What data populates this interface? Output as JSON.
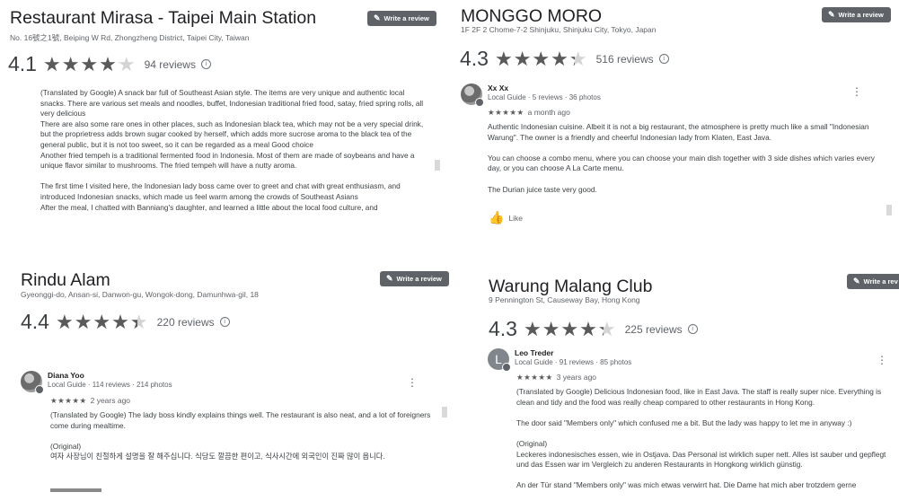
{
  "common": {
    "write_review_label": "Write a review",
    "write_review_short": "Write a rev",
    "like_label": "Like"
  },
  "panels": [
    {
      "name": "Restaurant Mirasa - Taipei Main Station",
      "address": "No. 16號之1號, Beiping W Rd, Zhongzheng District, Taipei City, Taiwan",
      "rating": "4.1",
      "rating_value": 4.1,
      "reviews": "94 reviews",
      "body": [
        "(Translated by Google) A snack bar full of Southeast Asian style. The items are very unique and authentic local snacks. There are various set meals and noodles, buffet, Indonesian traditional fried food, satay, fried spring rolls, all very delicious",
        "There are also some rare ones in other places, such as Indonesian black tea, which may not be a very special drink, but the proprietress adds brown sugar cooked by herself, which adds more sucrose aroma to the black tea of the general public, but it is not too sweet, so it can be regarded as a meal Good choice",
        "Another fried tempeh is a traditional fermented food in Indonesia. Most of them are made of soybeans and have a unique flavor similar to mushrooms. The fried tempeh will have a nutty aroma.",
        "The first time I visited here, the Indonesian lady boss came over to greet and chat with great enthusiasm, and introduced Indonesian snacks, which made us feel warm among the crowds of Southeast Asians",
        "After the meal, I chatted with Banniang's daughter, and learned a little about the local food culture, and"
      ]
    },
    {
      "name": "MONGGO MORO",
      "address": "1F 2F 2 Chome-7-2 Shinjuku, Shinjuku City, Tokyo, Japan",
      "rating": "4.3",
      "rating_value": 4.3,
      "reviews": "516 reviews",
      "reviewer": {
        "name": "Xx Xx",
        "meta": "Local Guide · 5 reviews · 36 photos",
        "stars": "★★★★★",
        "when": "a month ago"
      },
      "body": [
        "Authentic Indonesian cuisine. Albeit it is not a big restaurant, the atmosphere is pretty much like a small \"Indonesian Warung\". The owner is a friendly and cheerful Indonesian lady from Klaten, East Java.",
        "You can choose a combo menu, where you can choose your main dish together with 3 side dishes which varies every day, or you can choose A La Carte menu.",
        "The Durian juice taste very good."
      ]
    },
    {
      "name": "Rindu Alam",
      "address": "Gyeonggi-do, Ansan-si, Danwon-gu, Wongok-dong, Damunhwa-gil, 18",
      "rating": "4.4",
      "rating_value": 4.4,
      "reviews": "220 reviews",
      "reviewer": {
        "name": "Diana Yoo",
        "meta": "Local Guide · 114 reviews · 214 photos",
        "stars": "★★★★★",
        "when": "2 years ago"
      },
      "body": [
        "(Translated by Google) The lady boss kindly explains things well. The restaurant is also neat, and a lot of foreigners come during mealtime.",
        "(Original)",
        "여자 사장님이 친절하게 설명을 잘 해주십니다. 식당도 깔끔한 편이고, 식사시간에 외국인이 진짜 많이 옵니다."
      ]
    },
    {
      "name": "Warung Malang Club",
      "address": "9 Pennington St, Causeway Bay, Hong Kong",
      "rating": "4.3",
      "rating_value": 4.3,
      "reviews": "225 reviews",
      "reviewer": {
        "initial": "L",
        "name": "Leo Treder",
        "meta": "Local Guide · 91 reviews · 85 photos",
        "stars": "★★★★★",
        "when": "3 years ago"
      },
      "body": [
        "(Translated by Google) Delicious Indonesian food, like in East Java. The staff is really super nice. Everything is clean and tidy and the food was really cheap compared to other restaurants in Hong Kong.",
        "The door said \"Members only\" which confused me a bit. But the lady was happy to let me in anyway :)",
        "(Original)",
        "Leckeres indonesisches essen, wie in Ostjava. Das Personal ist wirklich super nett. Alles ist sauber und gepflegt und das Essen war im Vergleich zu anderen Restaurants in Hongkong wirklich günstig.",
        "An der Tür stand \"Members only\" was mich etwas verwirrt hat. Die Dame hat mich aber trotzdem gerne"
      ]
    }
  ]
}
